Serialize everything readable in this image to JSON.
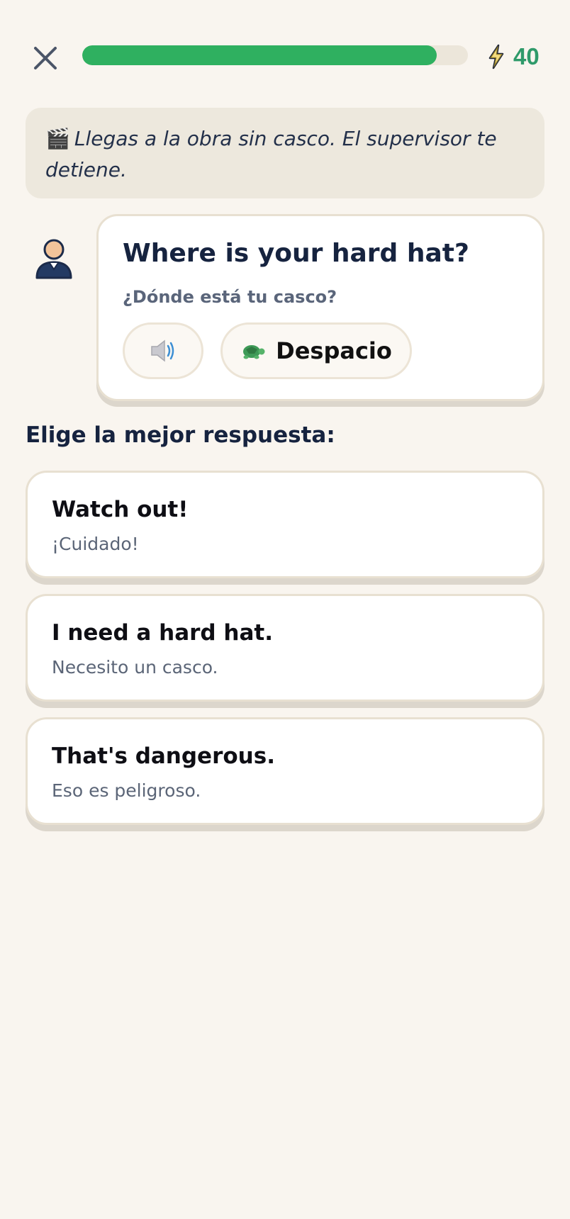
{
  "header": {
    "close_icon": "close-icon",
    "progress": 0.92,
    "streak_icon": "lightning-icon",
    "streak_count": "40",
    "colors": {
      "progress_fill": "#2fb060",
      "streak": "#2f9a6a"
    }
  },
  "scene": {
    "icon": "clapperboard-icon",
    "text": "Llegas a la obra sin casco. El supervisor te detiene."
  },
  "speaker": {
    "avatar_icon": "person-avatar-icon",
    "line": "Where is your hard hat?",
    "translation": "¿Dónde está tu casco?",
    "audio_icon": "speaker-icon",
    "slow_icon": "turtle-icon",
    "slow_label": "Despacio"
  },
  "prompt": "Elige la mejor respuesta:",
  "options": [
    {
      "text": "Watch out!",
      "translation": "¡Cuidado!"
    },
    {
      "text": "I need a hard hat.",
      "translation": "Necesito un casco."
    },
    {
      "text": "That's dangerous.",
      "translation": "Eso es peligroso."
    }
  ]
}
